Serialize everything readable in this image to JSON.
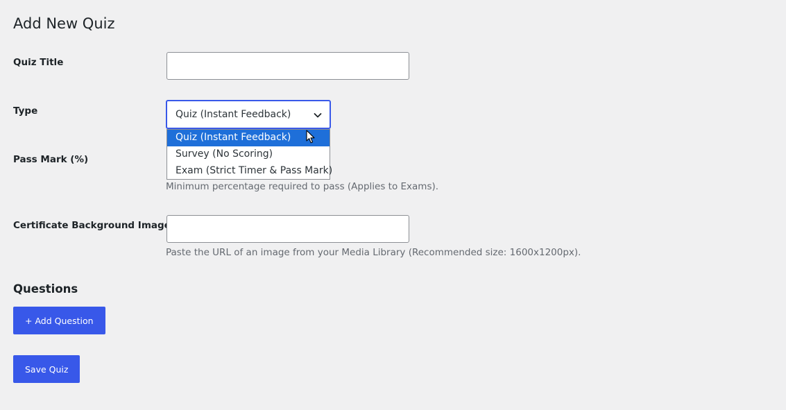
{
  "page": {
    "title": "Add New Quiz"
  },
  "form": {
    "quiz_title": {
      "label": "Quiz Title",
      "value": ""
    },
    "type": {
      "label": "Type",
      "selected": "Quiz (Instant Feedback)",
      "options": [
        "Quiz (Instant Feedback)",
        "Survey (No Scoring)",
        "Exam (Strict Timer & Pass Mark)"
      ],
      "highlighted_index": 0
    },
    "pass_mark": {
      "label": "Pass Mark (%)",
      "description": "Minimum percentage required to pass (Applies to Exams)."
    },
    "certificate_bg": {
      "label": "Certificate Background Image",
      "value": "",
      "description": "Paste the URL of an image from your Media Library (Recommended size: 1600x1200px)."
    }
  },
  "questions": {
    "heading": "Questions",
    "add_label": "+ Add Question"
  },
  "actions": {
    "save_label": "Save Quiz"
  },
  "colors": {
    "background": "#f0f0f1",
    "accent": "#3858e9",
    "dropdown_highlight": "#1e6fd9",
    "description_text": "#646970"
  },
  "icons": {
    "select_chevron": "chevron-down-icon",
    "pointer": "mouse-cursor-icon"
  }
}
